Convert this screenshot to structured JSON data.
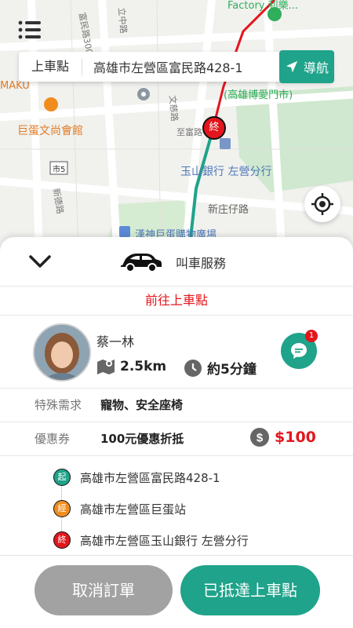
{
  "map": {
    "labels": {
      "store_top": "Factory 利樂...",
      "maku": "MAKU",
      "venue": "巨蛋文尚會館",
      "ai_gate": "(高雄博愛門市)",
      "bank": "玉山銀行 左營分行",
      "xinzhuang": "新庄仔路",
      "mall": "漢神巨蛋購物廣場",
      "road_fu": "富民路300巷",
      "road_li": "立中路",
      "road_wen": "文慈路",
      "road_zhi": "至富路",
      "road_xin": "新德路",
      "road_sign": "市5",
      "end_marker": "終"
    }
  },
  "address_bar": {
    "label": "上車點",
    "address": "高雄市左營區富民路428-1"
  },
  "nav_button": {
    "label": "導航"
  },
  "sheet": {
    "service": "叫車服務",
    "status": "前往上車點",
    "driver": {
      "name": "蔡一林",
      "distance": "2.5km",
      "eta": "約5分鐘",
      "chat_badge": "1"
    },
    "special": {
      "label": "特殊需求",
      "value": "寵物、安全座椅"
    },
    "coupon": {
      "label": "優惠券",
      "value": "100元優惠折抵",
      "amount": "$100"
    },
    "stops": [
      {
        "marker": "起",
        "address": "高雄市左營區富民路428-1",
        "color": "#1fa38a"
      },
      {
        "marker": "經",
        "address": "高雄市左營區巨蛋站",
        "color": "#f08c1d"
      },
      {
        "marker": "終",
        "address": "高雄市左營區玉山銀行 左營分行",
        "color": "#e3161d"
      }
    ]
  },
  "actions": {
    "cancel": "取消訂單",
    "arrived": "已抵達上車點"
  },
  "colors": {
    "accent": "#1fa38a",
    "danger": "#e3161d",
    "orange": "#f08c1d"
  }
}
